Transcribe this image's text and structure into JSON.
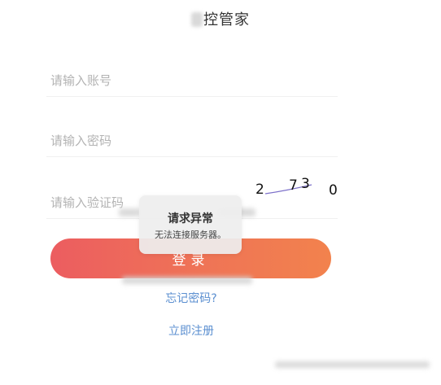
{
  "header": {
    "title": "控管家"
  },
  "form": {
    "account_placeholder": "请输入账号",
    "password_placeholder": "请输入密码",
    "code_placeholder": "请输入验证码",
    "captcha_chars": [
      "2",
      "7",
      "3",
      "0"
    ],
    "login_label": "登录"
  },
  "toast": {
    "title": "请求异常",
    "message": "无法连接服务器。"
  },
  "links": {
    "forgot_password": "忘记密码?",
    "register": "立即注册"
  },
  "colors": {
    "button_start": "#ec5d60",
    "button_end": "#f2824d",
    "link": "#5b8fd0",
    "placeholder": "#b3b3b3"
  }
}
